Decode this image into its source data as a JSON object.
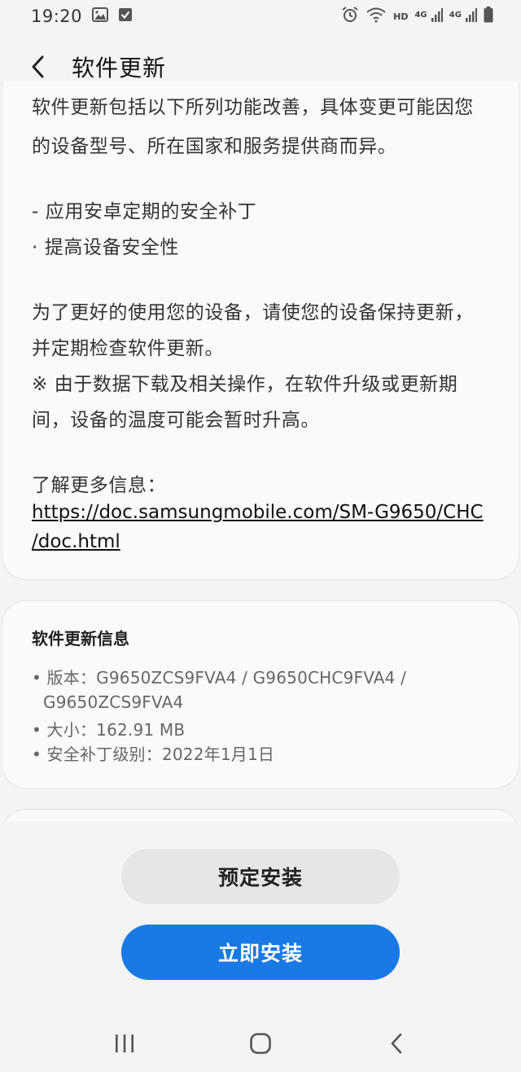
{
  "status_bar": {
    "time": "19:20",
    "hd_label": "HD",
    "net1_label": "4G",
    "net2_label": "4G"
  },
  "header": {
    "title": "软件更新"
  },
  "description": {
    "clipped_line": "软件更新包括以下所列功能改善，具体变更可能因您",
    "lines": [
      "的设备型号、所在国家和服务提供商而异。",
      "- 应用安卓定期的安全补丁",
      "· 提高设备安全性",
      "为了更好的使用您的设备，请使您的设备保持更新，",
      "并定期检查软件更新。",
      "※ 由于数据下载及相关操作，在软件升级或更新期",
      "间，设备的温度可能会暂时升高。",
      "了解更多信息："
    ],
    "link_line1": "https://doc.samsungmobile.com/SM-G9650/CHC",
    "link_line2": "/doc.html"
  },
  "update_info": {
    "title": "软件更新信息",
    "version_line1": "• 版本：G9650ZCS9FVA4 / G9650CHC9FVA4 /",
    "version_line2": "G9650ZCS9FVA4",
    "size": "• 大小：162.91 MB",
    "security_patch": "• 安全补丁级别：2022年1月1日"
  },
  "buttons": {
    "schedule_label": "预定安装",
    "install_label": "立即安装"
  },
  "colors": {
    "accent": "#1979e6",
    "background": "#f4f4f4",
    "card": "#fafafa"
  }
}
